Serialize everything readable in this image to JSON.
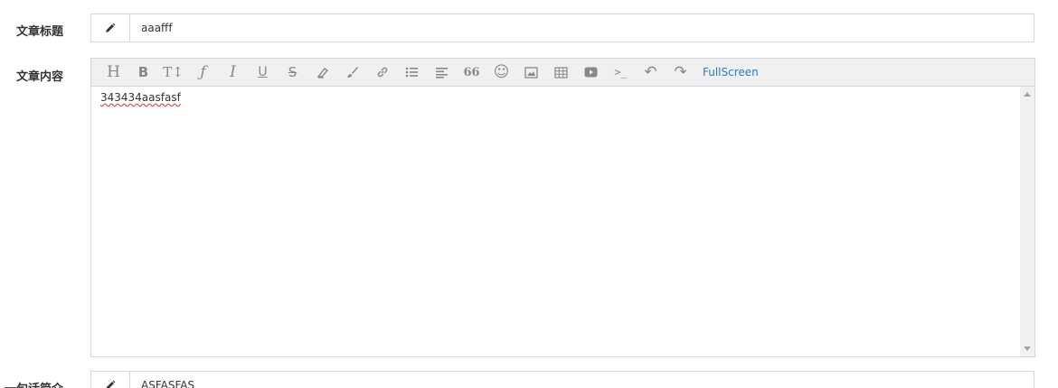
{
  "form": {
    "title_label": "文章标题",
    "title_value": "aaafff",
    "content_label": "文章内容",
    "summary_label": "一句话简介",
    "summary_value": "ASFASFAS"
  },
  "editor": {
    "content": "343434aasfasf",
    "fullscreen_label": "FullScreen",
    "toolbar": [
      {
        "name": "heading",
        "glyph": "H"
      },
      {
        "name": "bold",
        "glyph": "B"
      },
      {
        "name": "text-size",
        "glyph": "T↕"
      },
      {
        "name": "font",
        "glyph": "ƒ"
      },
      {
        "name": "italic",
        "glyph": "I"
      },
      {
        "name": "underline",
        "glyph": "U"
      },
      {
        "name": "strikethrough",
        "glyph": "S"
      },
      {
        "name": "eraser"
      },
      {
        "name": "brush"
      },
      {
        "name": "link"
      },
      {
        "name": "list"
      },
      {
        "name": "align"
      },
      {
        "name": "quote",
        "glyph": "66"
      },
      {
        "name": "emoji",
        "glyph": "☺"
      },
      {
        "name": "image"
      },
      {
        "name": "table"
      },
      {
        "name": "video"
      },
      {
        "name": "code",
        "glyph": ">_"
      },
      {
        "name": "undo",
        "glyph": "↶"
      },
      {
        "name": "redo",
        "glyph": "↷"
      }
    ]
  },
  "icons": {
    "addon_icon": "pencil-icon"
  },
  "colors": {
    "link": "#337ab7",
    "border": "#d2d6de",
    "toolbar_bg": "#f0f0f0",
    "icon": "#888888"
  }
}
